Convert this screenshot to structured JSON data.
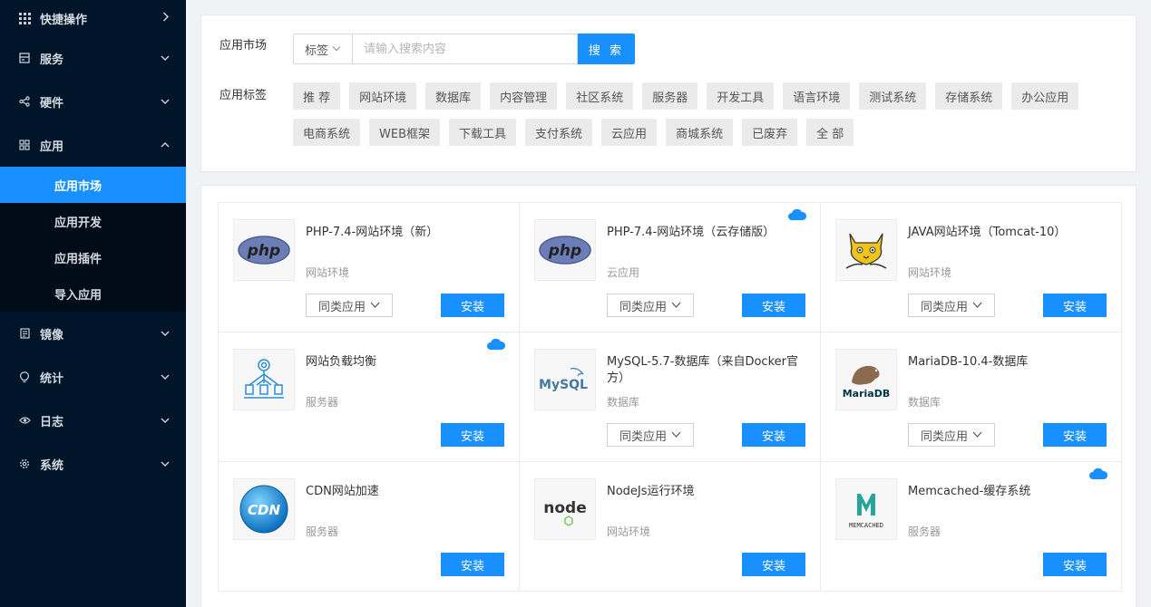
{
  "sidebar": {
    "items": [
      {
        "label": "快捷操作",
        "icon": "grid-icon",
        "chevron": "›"
      },
      {
        "label": "服务",
        "icon": "server-icon",
        "chevron": "⌄"
      },
      {
        "label": "硬件",
        "icon": "share-icon",
        "chevron": "⌄"
      },
      {
        "label": "应用",
        "icon": "apps-icon",
        "chevron": "⌃"
      }
    ],
    "sub_items": [
      {
        "label": "应用市场",
        "active": true
      },
      {
        "label": "应用开发"
      },
      {
        "label": "应用插件"
      },
      {
        "label": "导入应用"
      }
    ],
    "items_after": [
      {
        "label": "镜像",
        "icon": "file-icon",
        "chevron": "⌄"
      },
      {
        "label": "统计",
        "icon": "bulb-icon",
        "chevron": "⌄"
      },
      {
        "label": "日志",
        "icon": "eye-icon",
        "chevron": "⌄"
      },
      {
        "label": "系统",
        "icon": "gear-icon",
        "chevron": "⌄"
      }
    ]
  },
  "filter": {
    "market_label": "应用市场",
    "tag_select": "标签",
    "search_placeholder": "请输入搜索内容",
    "search_button": "搜 索",
    "tags_label": "应用标签",
    "tags": [
      "推 荐",
      "网站环境",
      "数据库",
      "内容管理",
      "社区系统",
      "服务器",
      "开发工具",
      "语言环境",
      "测试系统",
      "存储系统",
      "办公应用",
      "电商系统",
      "WEB框架",
      "下载工具",
      "支付系统",
      "云应用",
      "商城系统",
      "已废弃",
      "全 部"
    ]
  },
  "apps": [
    {
      "name": "PHP-7.4-网站环境（新）",
      "category": "网站环境",
      "logo": "php-logo",
      "similar": "同类应用",
      "install": "安装",
      "cloud": false,
      "has_similar": true
    },
    {
      "name": "PHP-7.4-网站环境（云存储版）",
      "category": "云应用",
      "logo": "php-logo",
      "similar": "同类应用",
      "install": "安装",
      "cloud": true,
      "has_similar": true
    },
    {
      "name": "JAVA网站环境（Tomcat-10）",
      "category": "网站环境",
      "logo": "tomcat-logo",
      "similar": "同类应用",
      "install": "安装",
      "cloud": false,
      "has_similar": true
    },
    {
      "name": "网站负载均衡",
      "category": "服务器",
      "logo": "loadbalance-logo",
      "similar": "",
      "install": "安装",
      "cloud": true,
      "has_similar": false
    },
    {
      "name": "MySQL-5.7-数据库（来自Docker官方）",
      "category": "数据库",
      "logo": "mysql-logo",
      "similar": "同类应用",
      "install": "安装",
      "cloud": false,
      "has_similar": true
    },
    {
      "name": "MariaDB-10.4-数据库",
      "category": "数据库",
      "logo": "mariadb-logo",
      "similar": "同类应用",
      "install": "安装",
      "cloud": false,
      "has_similar": true
    },
    {
      "name": "CDN网站加速",
      "category": "服务器",
      "logo": "cdn-logo",
      "similar": "",
      "install": "安装",
      "cloud": false,
      "has_similar": false
    },
    {
      "name": "NodeJs运行环境",
      "category": "网站环境",
      "logo": "node-logo",
      "similar": "",
      "install": "安装",
      "cloud": false,
      "has_similar": false
    },
    {
      "name": "Memcached-缓存系统",
      "category": "服务器",
      "logo": "memcached-logo",
      "similar": "",
      "install": "安装",
      "cloud": true,
      "has_similar": false
    }
  ],
  "logo_text": {
    "php": "php",
    "mysql": "MySQL",
    "mariadb": "MariaDB",
    "cdn": "CDN",
    "node": "node",
    "memcached": "MEMCACHED"
  },
  "colors": {
    "sidebar_bg": "#001529",
    "accent": "#1890ff",
    "submenu_bg": "#000c17"
  }
}
